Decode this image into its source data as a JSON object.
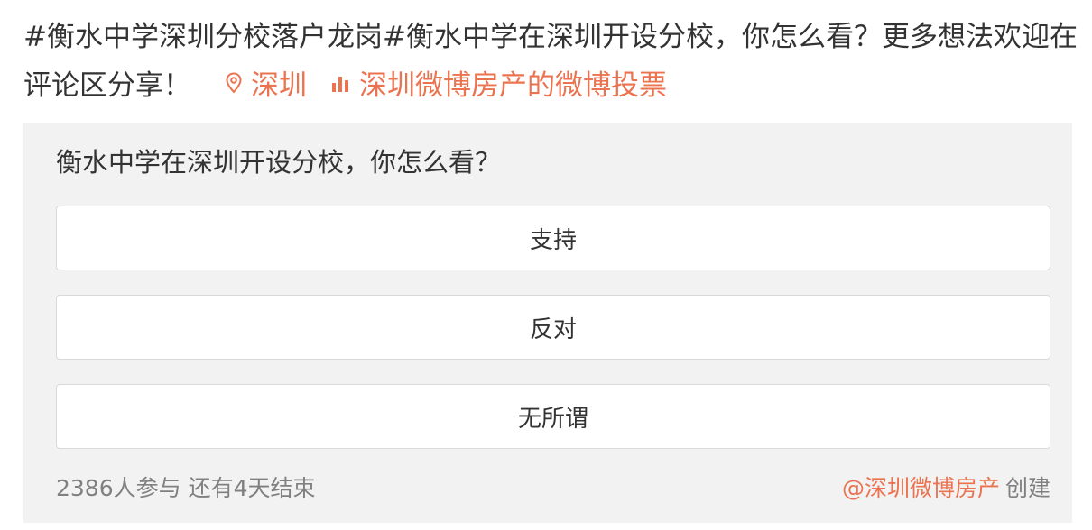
{
  "post": {
    "text": "#衡水中学深圳分校落户龙岗#衡水中学在深圳开设分校，你怎么看？更多想法欢迎在评论区分享！",
    "location": {
      "icon": "location-pin-icon",
      "label": "深圳"
    },
    "vote_link": {
      "icon": "bar-chart-icon",
      "label": "深圳微博房产的微博投票"
    }
  },
  "poll": {
    "question": "衡水中学在深圳开设分校，你怎么看？",
    "options": [
      {
        "label": "支持"
      },
      {
        "label": "反对"
      },
      {
        "label": "无所谓"
      }
    ],
    "stats": "2386人参与 还有4天结束",
    "creator": {
      "name": "@深圳微博房产",
      "suffix": "创建"
    }
  },
  "colors": {
    "accent": "#eb7350",
    "text": "#333333",
    "muted": "#808080",
    "poll_bg": "#f2f2f2",
    "option_border": "#d9d9d9"
  }
}
